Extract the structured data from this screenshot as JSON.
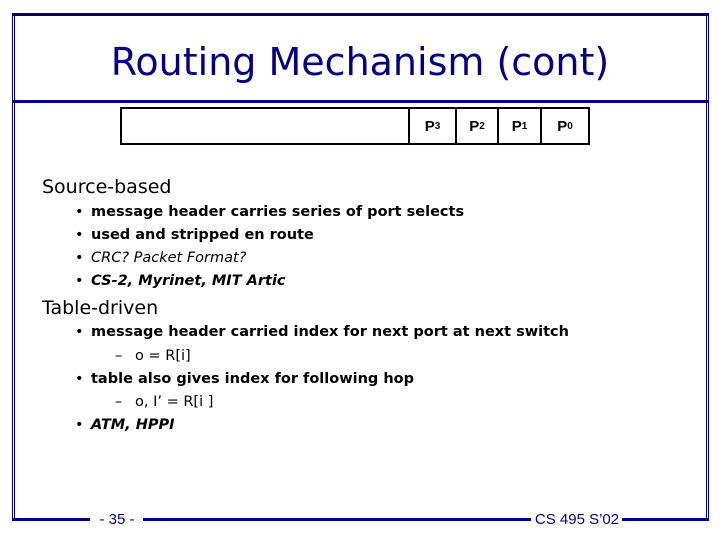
{
  "slide": {
    "title": "Routing Mechanism (cont)",
    "packet": {
      "fields": [
        {
          "base": "P",
          "sub": "3"
        },
        {
          "base": "P",
          "sub": "2"
        },
        {
          "base": "P",
          "sub": "1"
        },
        {
          "base": "P",
          "sub": "0"
        }
      ]
    },
    "sections": [
      {
        "heading": "Source-based",
        "items": [
          {
            "text": "message header carries series of port selects",
            "style": "bold"
          },
          {
            "text": "used and stripped en route",
            "style": "bold"
          },
          {
            "text": "CRC? Packet Format?",
            "style": "italic"
          },
          {
            "text": "CS-2, Myrinet, MIT Artic",
            "style": "bold-italic"
          }
        ]
      },
      {
        "heading": "Table-driven",
        "items": [
          {
            "text": "message header carried index for next port at next switch",
            "style": "bold",
            "sub": "o = R[i]"
          },
          {
            "text": "table also gives index for following hop",
            "style": "bold",
            "sub": "o, I’ = R[i ]"
          },
          {
            "text": "ATM, HPPI",
            "style": "bold-italic"
          }
        ]
      }
    ],
    "bullet_glyph": "•",
    "dash_glyph": "–",
    "footer": {
      "page": "- 35 -",
      "course": "CS 495 S’02"
    },
    "colors": {
      "accent": "#000080",
      "text": "#000000"
    }
  }
}
